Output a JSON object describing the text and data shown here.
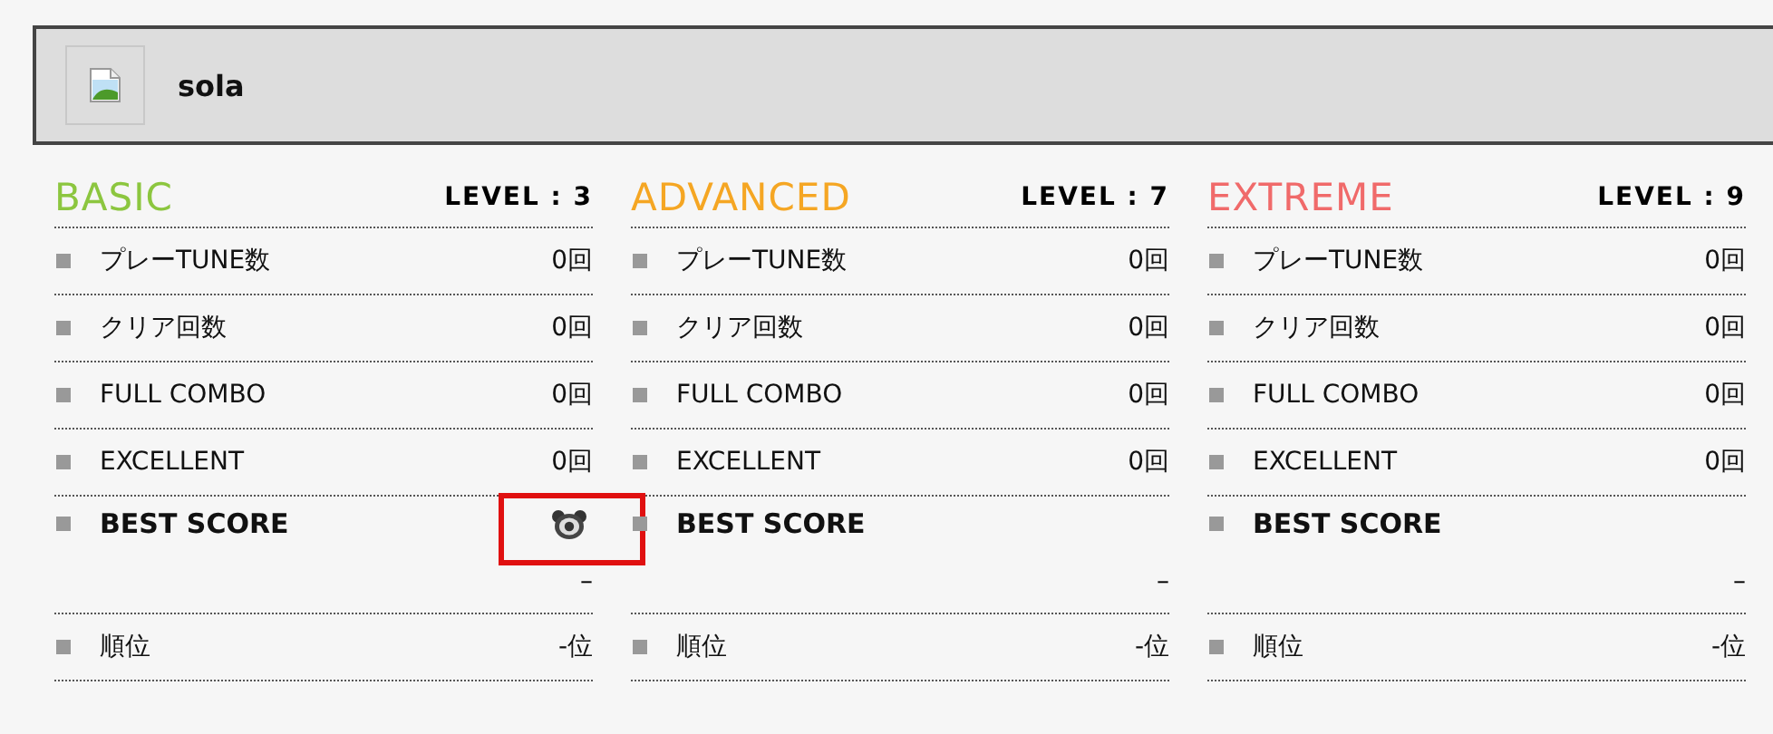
{
  "header": {
    "title": "sola"
  },
  "charts": [
    {
      "difficulty": "BASIC",
      "color": "#8cc63f",
      "level": "LEVEL : 3",
      "stats": [
        {
          "label": "プレーTUNE数",
          "value": "0回"
        },
        {
          "label": "クリア回数",
          "value": "0回"
        },
        {
          "label": "FULL COMBO",
          "value": "0回"
        },
        {
          "label": "EXCELLENT",
          "value": "0回"
        }
      ],
      "best_score": {
        "label": "BEST SCORE",
        "badge": true,
        "highlighted": true,
        "value": "–"
      },
      "rank": {
        "label": "順位",
        "value": "-位"
      }
    },
    {
      "difficulty": "ADVANCED",
      "color": "#f5a623",
      "level": "LEVEL : 7",
      "stats": [
        {
          "label": "プレーTUNE数",
          "value": "0回"
        },
        {
          "label": "クリア回数",
          "value": "0回"
        },
        {
          "label": "FULL COMBO",
          "value": "0回"
        },
        {
          "label": "EXCELLENT",
          "value": "0回"
        }
      ],
      "best_score": {
        "label": "BEST SCORE",
        "badge": false,
        "highlighted": false,
        "value": "–"
      },
      "rank": {
        "label": "順位",
        "value": "-位"
      }
    },
    {
      "difficulty": "EXTREME",
      "color": "#f06a6a",
      "level": "LEVEL : 9",
      "stats": [
        {
          "label": "プレーTUNE数",
          "value": "0回"
        },
        {
          "label": "クリア回数",
          "value": "0回"
        },
        {
          "label": "FULL COMBO",
          "value": "0回"
        },
        {
          "label": "EXCELLENT",
          "value": "0回"
        }
      ],
      "best_score": {
        "label": "BEST SCORE",
        "badge": false,
        "highlighted": false,
        "value": "–"
      },
      "rank": {
        "label": "順位",
        "value": "-位"
      }
    }
  ]
}
